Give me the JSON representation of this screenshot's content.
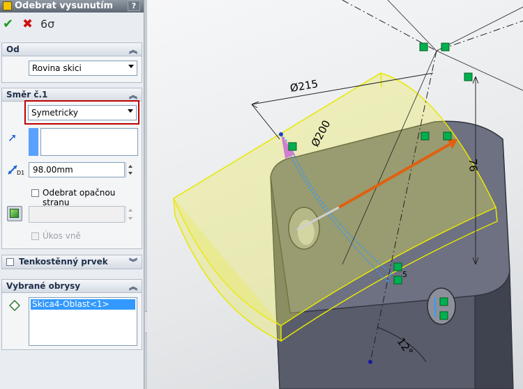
{
  "window": {
    "title": "Odebrat vysunutím",
    "help_label": "?"
  },
  "toolbar": {
    "ok_label": "✔",
    "cancel_label": "✖",
    "preview_label": "6σ"
  },
  "section_from": {
    "header": "Od",
    "start_condition": "Rovina skici"
  },
  "section_direction1": {
    "header": "Směr č.1",
    "end_condition": "Symetricky",
    "depth_value": "98.00mm",
    "depth_icon_label": "D1",
    "flip_side_label": "Odebrat opačnou stranu",
    "draft_outward_label": "Úkos vně"
  },
  "section_thin": {
    "header": "Tenkostěnný prvek"
  },
  "section_contours": {
    "header": "Vybrané obrysy",
    "items": [
      "Skica4-Oblast<1>"
    ]
  },
  "viewport": {
    "dimensions": {
      "dia_large": "Ø215",
      "dia_small": "Ø200",
      "height": "76",
      "angle": "12°",
      "small_label": "5"
    }
  },
  "colors": {
    "highlight_outline": "#c00000",
    "selection_blue": "#3399ff",
    "preview_yellow": "#e8e800",
    "drag_arrow": "#e06010",
    "relation_green": "#00b050"
  }
}
